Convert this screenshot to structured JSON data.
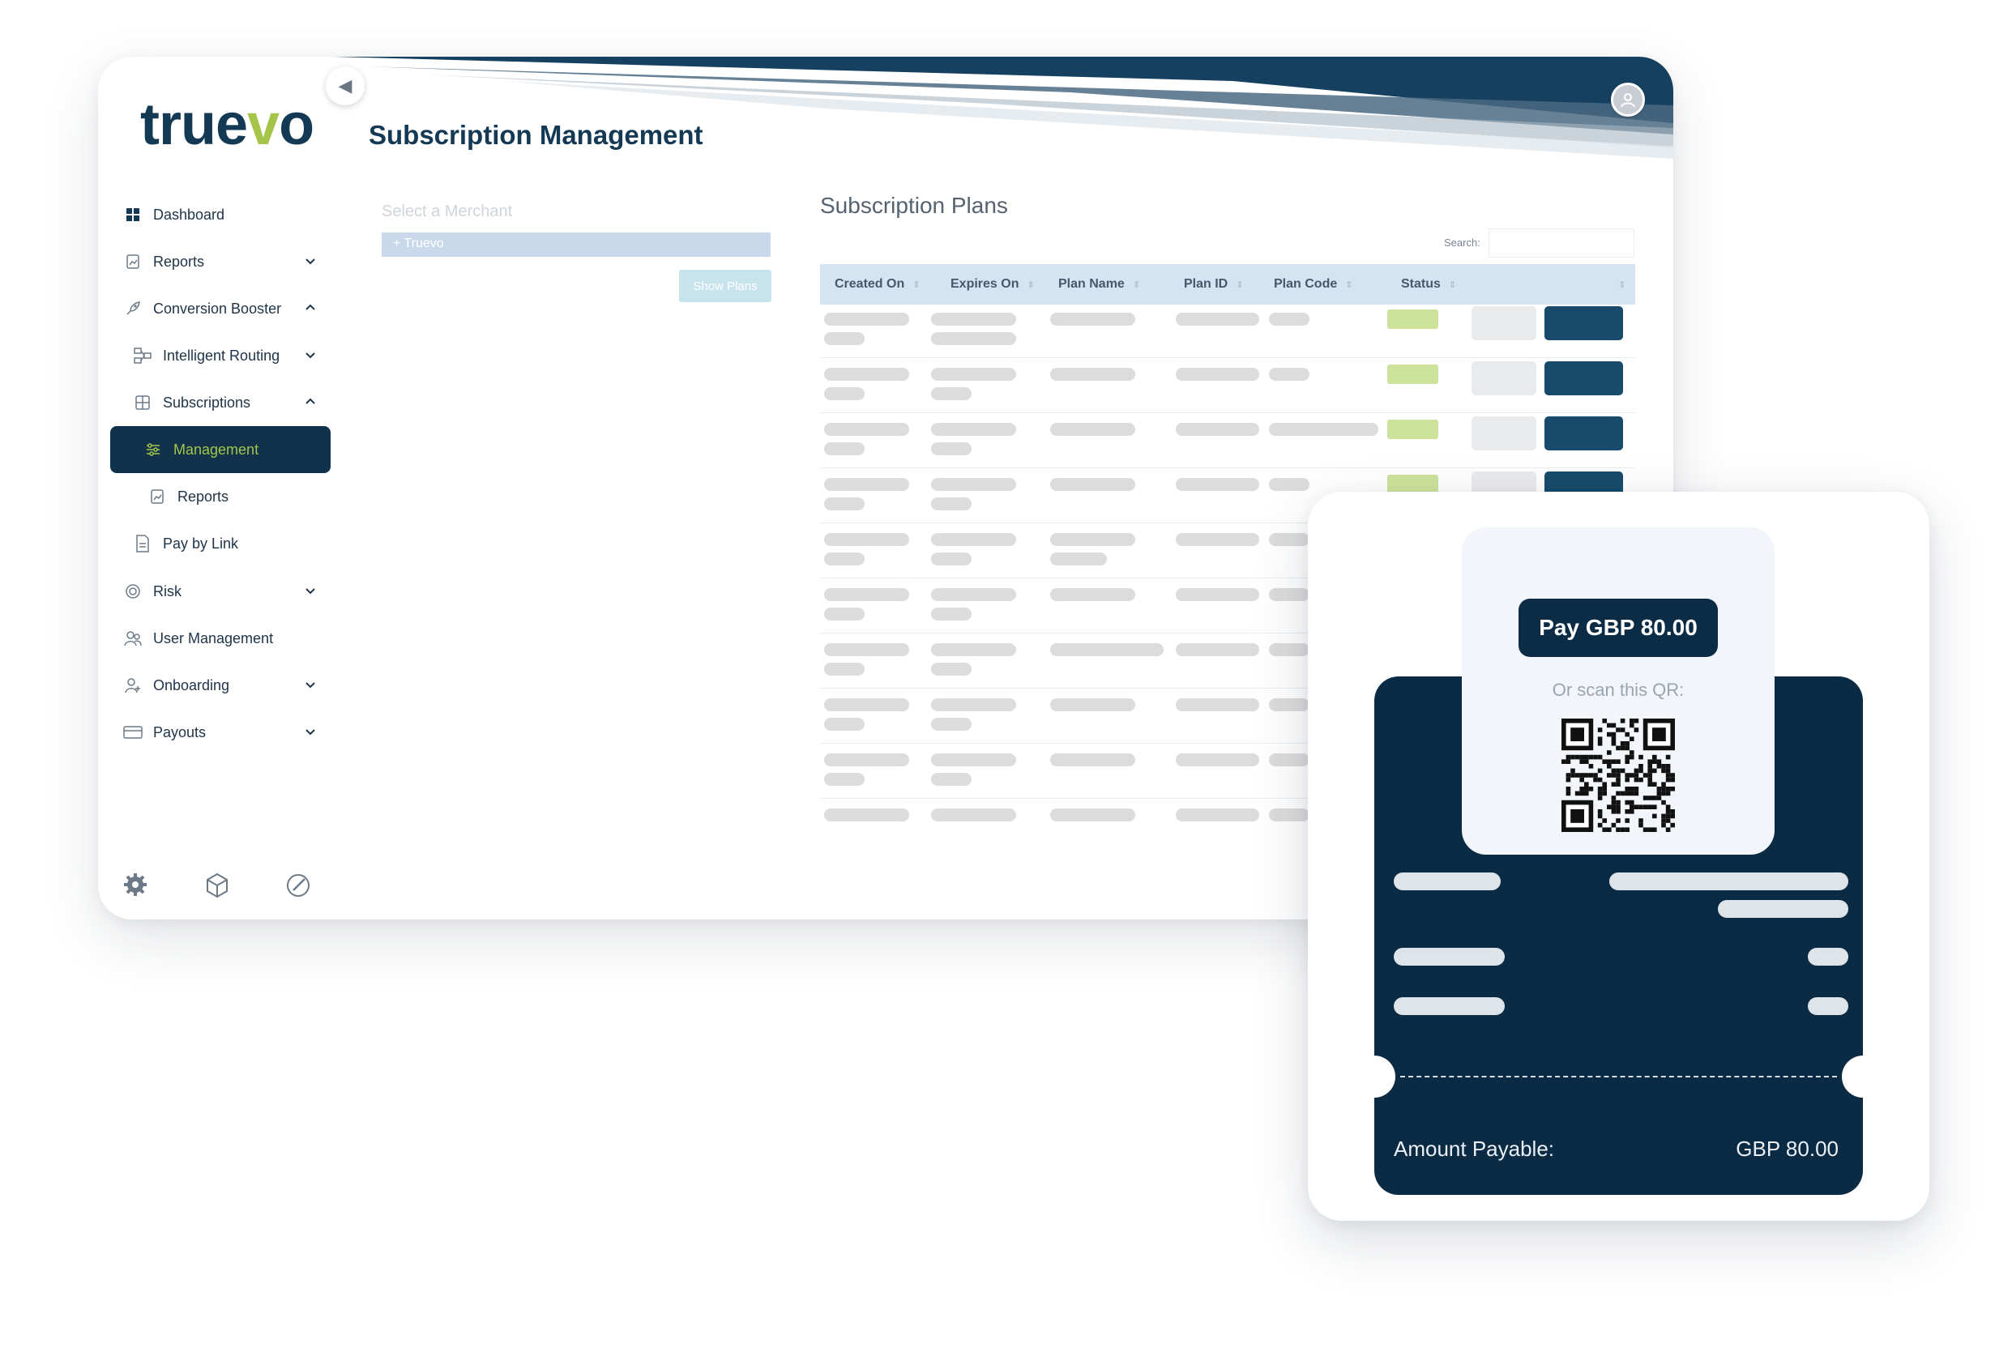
{
  "brand": {
    "logo_start": "true",
    "logo_v": "v",
    "logo_end": "o",
    "accent": "#a4c549",
    "primary": "#143954"
  },
  "header": {
    "page_title": "Subscription Management"
  },
  "sidebar": {
    "items": [
      {
        "label": "Dashboard"
      },
      {
        "label": "Reports"
      },
      {
        "label": "Conversion Booster"
      },
      {
        "label": "Intelligent Routing"
      },
      {
        "label": "Subscriptions"
      },
      {
        "label": "Management"
      },
      {
        "label": "Reports"
      },
      {
        "label": "Pay by Link"
      },
      {
        "label": "Risk"
      },
      {
        "label": "User Management"
      },
      {
        "label": "Onboarding"
      },
      {
        "label": "Payouts"
      }
    ]
  },
  "merchant": {
    "label": "Select a Merchant",
    "selected": "Truevo",
    "show_plans": "Show Plans"
  },
  "plans": {
    "title": "Subscription Plans",
    "search_label": "Search:",
    "columns": [
      "Created On",
      "Expires On",
      "Plan Name",
      "Plan ID",
      "Plan Code",
      "Status"
    ]
  },
  "payment": {
    "pay_button": "Pay GBP 80.00",
    "scan_text": "Or scan this QR:",
    "amount_label": "Amount Payable:",
    "amount_value": "GBP 80.00"
  }
}
